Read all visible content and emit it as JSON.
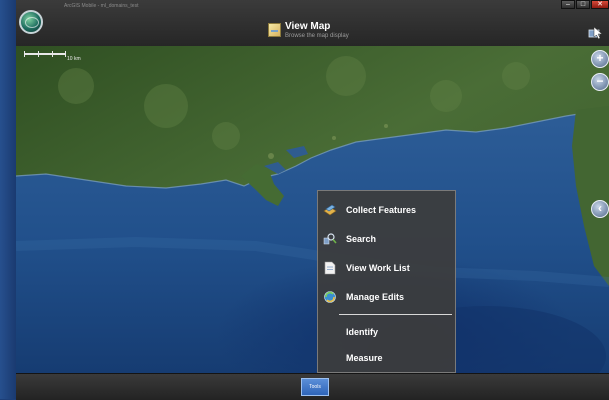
{
  "window": {
    "title": "ArcGIS Mobile - ml_domains_test",
    "controls": {
      "minimize": "–",
      "maximize": "□",
      "close": "✕"
    }
  },
  "header": {
    "title": "View Map",
    "subtitle": "Browse the map display",
    "view_icon": "map-icon",
    "tool_icon": "pan-tool-icon"
  },
  "map": {
    "scale_label": "10 km",
    "zoom_in": "+",
    "zoom_out": "−",
    "extra_button": "‹"
  },
  "tools_menu": {
    "items": [
      {
        "label": "Collect Features",
        "icon": "collect-features-icon"
      },
      {
        "label": "Search",
        "icon": "search-icon"
      },
      {
        "label": "View Work List",
        "icon": "work-list-icon"
      },
      {
        "label": "Manage Edits",
        "icon": "manage-edits-icon"
      },
      {
        "label": "Identify"
      },
      {
        "label": "Measure"
      }
    ]
  },
  "footer": {
    "tools_button": "Tools"
  },
  "colors": {
    "accent": "#3a74c9",
    "water": "#1f4a82",
    "land": "#3e6330",
    "popup": "#3c3c3c"
  }
}
